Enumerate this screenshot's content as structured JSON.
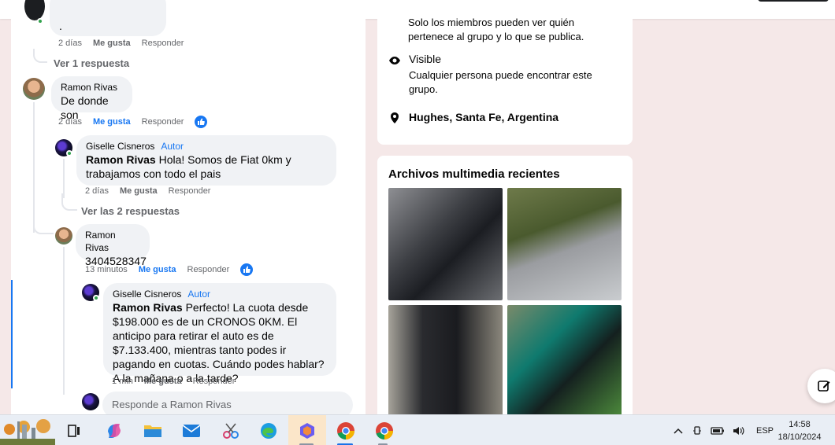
{
  "comments": {
    "top_comment": {
      "text": ".",
      "time": "2 días",
      "like": "Me gusta",
      "reply": "Responder"
    },
    "view_replies_1": "Ver 1 respuesta",
    "ramon1": {
      "name": "Ramon Rivas",
      "text": "De donde son",
      "time": "2 días",
      "like": "Me gusta",
      "reply": "Responder"
    },
    "giselle1": {
      "name": "Giselle Cisneros",
      "badge": "Autor",
      "mention": "Ramon Rivas",
      "text": " Hola! Somos de Fiat 0km y trabajamos con todo el pais",
      "time": "2 días",
      "like": "Me gusta",
      "reply": "Responder"
    },
    "view_replies_2": "Ver las 2 respuestas",
    "ramon2": {
      "name": "Ramon Rivas",
      "text": "3404528347",
      "time": "13 minutos",
      "like": "Me gusta",
      "reply": "Responder"
    },
    "giselle2": {
      "name": "Giselle Cisneros",
      "badge": "Autor",
      "mention": "Ramon Rivas",
      "text": " Perfecto! La cuota desde $198.000 es de un CRONOS 0KM. El anticipo para retirar el auto es de $7.133.400, mientras tanto podes ir pagando en cuotas. Cuándo podes hablar? A la mañana o a la tarde?",
      "time": "1 min",
      "like": "Me gusta",
      "reply": "Responder"
    },
    "reply_placeholder": "Responde a Ramon Rivas"
  },
  "group_info": {
    "private_desc": "Solo los miembros pueden ver quién pertenece al grupo y lo que se publica.",
    "visible_title": "Visible",
    "visible_desc": "Cualquier persona puede encontrar este grupo.",
    "location": "Hughes, Santa Fe, Argentina"
  },
  "media": {
    "title": "Archivos multimedia recientes"
  },
  "taskbar": {
    "language": "ESP",
    "time": "14:58",
    "date": "18/10/2024"
  },
  "icons": [
    "search-icon",
    "eye-icon",
    "location-pin-icon",
    "edit-icon",
    "like-icon",
    "task-view-icon",
    "copilot-icon",
    "file-explorer-icon",
    "mail-icon",
    "snipping-tool-icon",
    "edge-icon",
    "chrome-icon",
    "wifi-icon",
    "battery-icon",
    "volume-icon",
    "chevron-up-icon"
  ]
}
